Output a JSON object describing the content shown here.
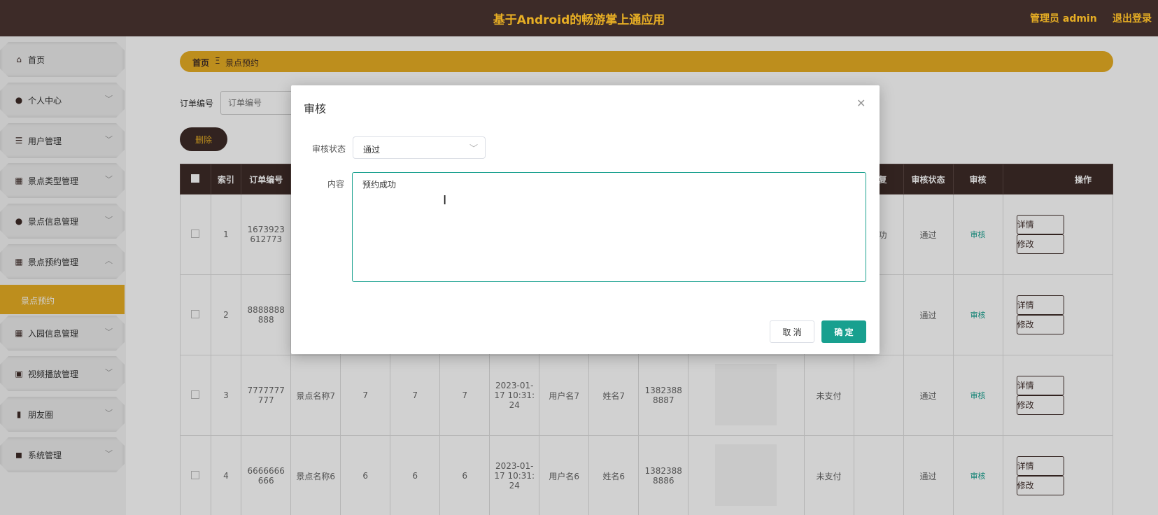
{
  "header": {
    "title": "基于Android的畅游掌上通应用",
    "admin": "管理员 admin",
    "logout": "退出登录"
  },
  "sidebar": {
    "items": [
      {
        "label": "首页",
        "icon": "home-icon",
        "glyph": "⌂",
        "arrow": ""
      },
      {
        "label": "个人中心",
        "icon": "user-icon",
        "glyph": "●",
        "arrow": "﹀"
      },
      {
        "label": "用户管理",
        "icon": "list-icon",
        "glyph": "☰",
        "arrow": "﹀"
      },
      {
        "label": "景点类型管理",
        "icon": "grid-icon",
        "glyph": "▦",
        "arrow": "﹀"
      },
      {
        "label": "景点信息管理",
        "icon": "user-icon",
        "glyph": "●",
        "arrow": "﹀"
      },
      {
        "label": "景点预约管理",
        "icon": "grid-icon",
        "glyph": "▦",
        "arrow": "︿"
      },
      {
        "label": "入园信息管理",
        "icon": "grid-icon",
        "glyph": "▦",
        "arrow": "﹀"
      },
      {
        "label": "视频播放管理",
        "icon": "trash-icon",
        "glyph": "▣",
        "arrow": "﹀"
      },
      {
        "label": "朋友圈",
        "icon": "bar-chart-icon",
        "glyph": "▮",
        "arrow": "﹀"
      },
      {
        "label": "系统管理",
        "icon": "camera-icon",
        "glyph": "◼",
        "arrow": "﹀"
      }
    ],
    "active_sub": "景点预约"
  },
  "breadcrumb": {
    "home": "首页",
    "sep": "Ξ",
    "current": "景点预约"
  },
  "search": {
    "label": "订单编号",
    "placeholder": "订单编号"
  },
  "toolbar": {
    "delete_label": "删除"
  },
  "table": {
    "headers": [
      "",
      "索引",
      "订单编号",
      "",
      "",
      "",
      "",
      "",
      "",
      "",
      "",
      "",
      "",
      "回复",
      "审核状态",
      "审核",
      "操作"
    ],
    "rows": [
      {
        "idx": "1",
        "order": "1673923612773",
        "name": "",
        "c1": "",
        "c2": "",
        "c3": "",
        "time": "",
        "user": "",
        "real": "",
        "phone": "",
        "pay": "",
        "reply": "成功",
        "status": "通过",
        "audit": "审核",
        "detail": "详情",
        "edit": "修改"
      },
      {
        "idx": "2",
        "order": "8888888888",
        "name": "",
        "c1": "",
        "c2": "",
        "c3": "",
        "time": "",
        "user": "",
        "real": "",
        "phone": "",
        "pay": "",
        "reply": "",
        "status": "通过",
        "audit": "审核",
        "detail": "详情",
        "edit": "修改"
      },
      {
        "idx": "3",
        "order": "7777777777",
        "name": "景点名称7",
        "c1": "7",
        "c2": "7",
        "c3": "7",
        "time": "2023-01-17 10:31:24",
        "user": "用户名7",
        "real": "姓名7",
        "phone": "13823888887",
        "pay": "未支付",
        "reply": "",
        "status": "通过",
        "audit": "审核",
        "detail": "详情",
        "edit": "修改"
      },
      {
        "idx": "4",
        "order": "6666666666",
        "name": "景点名称6",
        "c1": "6",
        "c2": "6",
        "c3": "6",
        "time": "2023-01-17 10:31:24",
        "user": "用户名6",
        "real": "姓名6",
        "phone": "13823888886",
        "pay": "未支付",
        "reply": "",
        "status": "通过",
        "audit": "审核",
        "detail": "详情",
        "edit": "修改"
      }
    ]
  },
  "modal": {
    "title": "审核",
    "status_label": "审核状态",
    "status_value": "通过",
    "content_label": "内容",
    "content_value": "预约成功",
    "cancel": "取 消",
    "confirm": "确 定"
  },
  "colors": {
    "brand_dark": "#3d2b28",
    "accent": "#e7ae24",
    "primary": "#18a08f"
  }
}
